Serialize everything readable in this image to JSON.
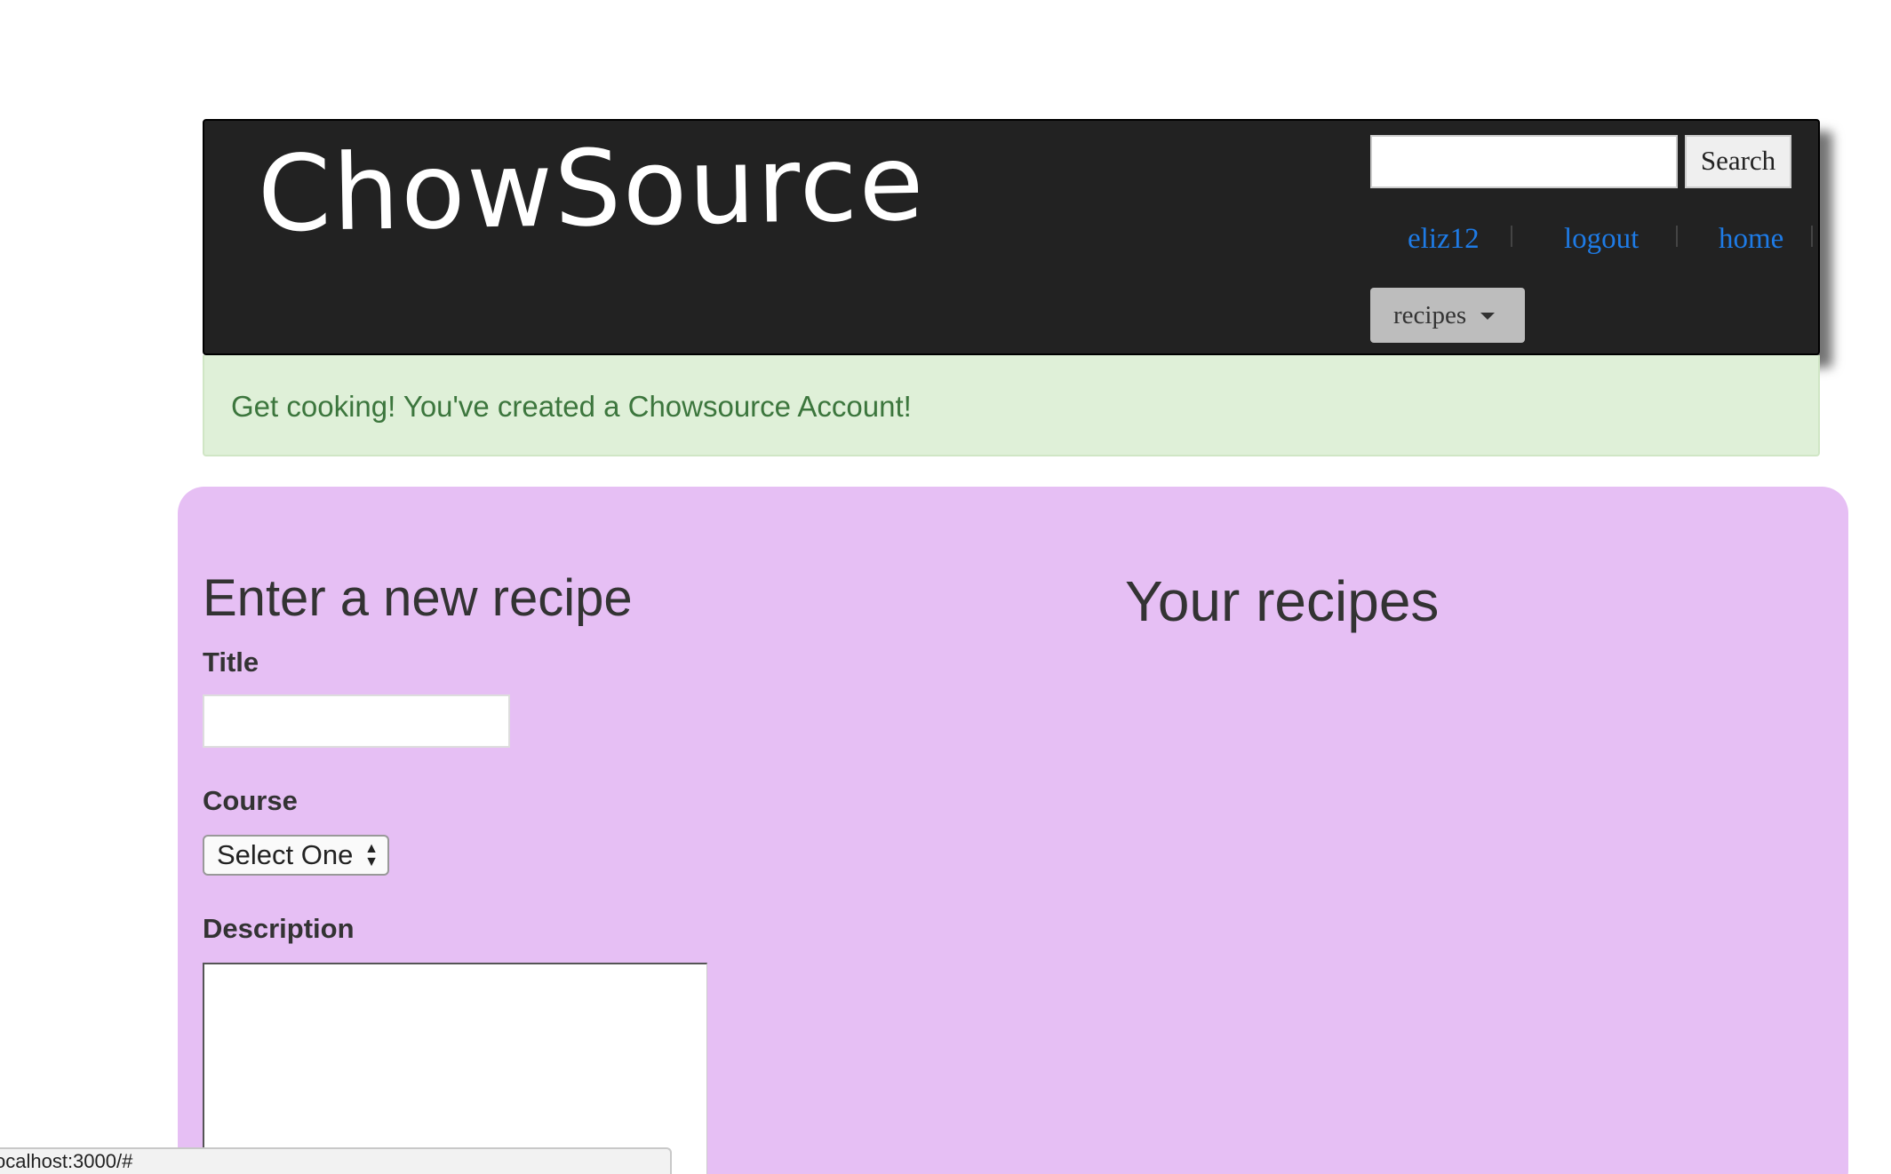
{
  "header": {
    "logo": "ChowSource",
    "search_button": "Search",
    "search_value": "",
    "nav": {
      "user": "eliz12",
      "logout": "logout",
      "home": "home"
    },
    "recipes_dropdown": "recipes"
  },
  "alert": {
    "message": "Get cooking! You've created a Chowsource Account!"
  },
  "form": {
    "heading": "Enter a new recipe",
    "title_label": "Title",
    "title_value": "",
    "course_label": "Course",
    "course_selected": "Select One",
    "description_label": "Description",
    "description_value": ""
  },
  "recipes_panel": {
    "heading": "Your recipes"
  },
  "status_bar": {
    "url": "ocalhost:3000/#"
  },
  "colors": {
    "header_bg": "#222222",
    "link": "#1e7be6",
    "alert_bg": "#dff0d8",
    "alert_text": "#3c763d",
    "main_bg": "#e6bff4"
  }
}
